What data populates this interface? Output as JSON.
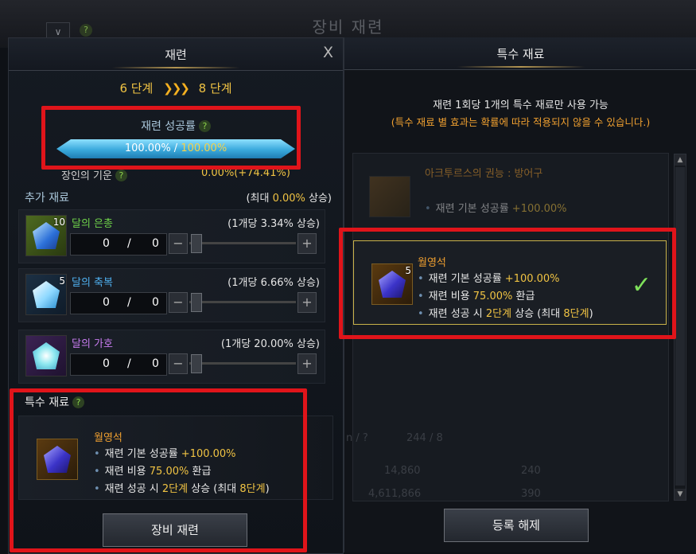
{
  "window": {
    "title": "장비 재련",
    "help": "?",
    "dropdown": "∨"
  },
  "left": {
    "title": "재련",
    "close": "X",
    "stage_from": "6 단계",
    "stage_arrows": "❯❯❯",
    "stage_to": "8 단계",
    "rate_label": "재련 성공률",
    "rate_main": "100.00%",
    "rate_sep": " / ",
    "rate_max": "100.00%",
    "rate_fill_percent": 100,
    "bonus_label": "장인의 기운",
    "bonus_value": "0.00%(+74.41%)",
    "extra_title": "추가 재료",
    "extra_max_prefix": "(최대 ",
    "extra_max_value": "0.00%",
    "extra_max_suffix": " 상승)",
    "materials": [
      {
        "name": "달의 은총",
        "count": "10",
        "rate": "(1개당 3.34% 상승)",
        "qty": "0",
        "max": "0",
        "color": "#6fd24a",
        "icon": "moon-grace-icon"
      },
      {
        "name": "달의 축복",
        "count": "5",
        "rate": "(1개당 6.66% 상승)",
        "qty": "0",
        "max": "0",
        "color": "#4fb0f0",
        "icon": "moon-blessing-icon"
      },
      {
        "name": "달의 가호",
        "count": "",
        "rate": "(1개당 20.00% 상승)",
        "qty": "0",
        "max": "0",
        "color": "#c87cf0",
        "icon": "moon-protection-icon"
      }
    ],
    "qty_sep": "/",
    "minus": "−",
    "plus": "+",
    "special_title": "특수 재료",
    "special": {
      "name": "월영석",
      "line1_text": "재련 기본 성공률 ",
      "line1_value": "+100.00%",
      "line2_text": "재련 비용 ",
      "line2_value": "75.00%",
      "line2_suffix": " 환급",
      "line3_text": "재련 성공 시 ",
      "line3_value": "2단계",
      "line3_mid": " 상승 (최대 ",
      "line3_value2": "8단계",
      "line3_suffix": ")"
    },
    "button": "장비 재련"
  },
  "right": {
    "title": "특수 재료",
    "notice": "재련 1회당 1개의 특수 재료만 사용 가능",
    "warning": "(특수 재료 별 효과는 확률에 따라 적용되지 않을 수 있습니다.)",
    "items": [
      {
        "name": "아크투르스의 권능 : 방어구",
        "line1_text": "재련 기본 성공률 ",
        "line1_value": "+100.00%"
      },
      {
        "name": "월영석",
        "count": "5",
        "line1_text": "재련 기본 성공률 ",
        "line1_value": "+100.00%",
        "line2_text": "재련 비용 ",
        "line2_value": "75.00%",
        "line2_suffix": " 환급",
        "line3_text": "재련 성공 시 ",
        "line3_value": "2단계",
        "line3_mid": " 상승 (최대 ",
        "line3_value2": "8단계",
        "line3_suffix": ")",
        "check": "✓"
      }
    ],
    "faded_bg": [
      "n / ?",
      "244 / 8",
      "14,860",
      "240",
      "4,611,866",
      "390"
    ],
    "button": "등록 해제",
    "scroll_up": "▲",
    "scroll_down": "▼"
  }
}
